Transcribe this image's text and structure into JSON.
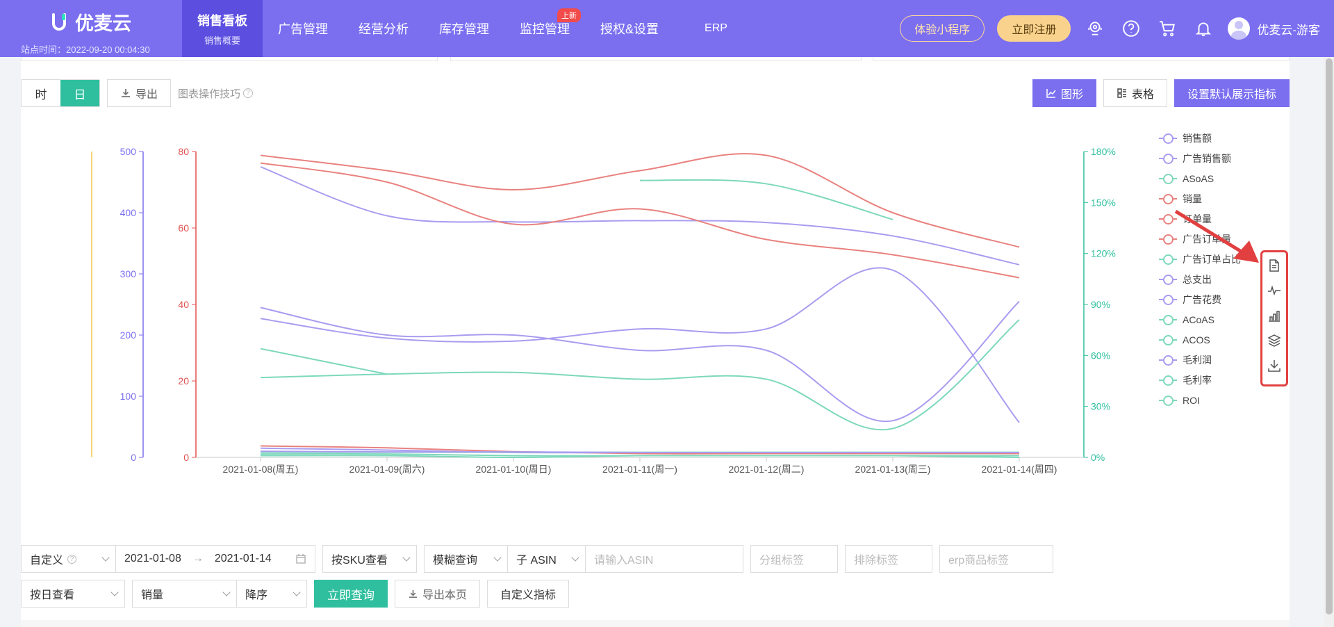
{
  "header": {
    "brand": "优麦云",
    "site_time": "站点时间：2022-09-20 00:04:30",
    "nav": [
      {
        "label": "销售看板",
        "sub": "销售概要",
        "active": true
      },
      {
        "label": "广告管理"
      },
      {
        "label": "经营分析"
      },
      {
        "label": "库存管理"
      },
      {
        "label": "监控管理",
        "badge": "上新"
      },
      {
        "label": "授权&设置"
      },
      {
        "label": "ERP"
      }
    ],
    "mini_program_button": "体验小程序",
    "register_button": "立即注册",
    "user_name": "优麦云-游客"
  },
  "toolbar": {
    "hour": "时",
    "day": "日",
    "export": "导出",
    "tips": "图表操作技巧",
    "graph": "图形",
    "table": "表格",
    "set_default": "设置默认展示指标"
  },
  "chart_data": {
    "type": "line",
    "categories": [
      "2021-01-08(周五)",
      "2021-01-09(周六)",
      "2021-01-10(周日)",
      "2021-01-11(周一)",
      "2021-01-12(周二)",
      "2021-01-13(周三)",
      "2021-01-14(周四)"
    ],
    "y_axes": [
      {
        "ticks": [
          "500",
          "400",
          "300",
          "200",
          "100",
          "0"
        ],
        "color": "#7b6ff0"
      },
      {
        "ticks": [
          "80",
          "60",
          "40",
          "20",
          "0"
        ],
        "color": "#e0514f"
      },
      {
        "ticks": [
          "180%",
          "150%",
          "120%",
          "90%",
          "60%",
          "30%",
          "0%"
        ],
        "color": "#2fbf9e"
      }
    ],
    "series": [
      {
        "name": "销售额",
        "color": "#a99cf0",
        "axis": 0,
        "values": [
          475,
          395,
          385,
          387,
          384,
          362,
          315
        ]
      },
      {
        "name": "广告销售额",
        "color": "#a99cf0",
        "axis": 0,
        "values": [
          227,
          195,
          190,
          210,
          210,
          306,
          57
        ]
      },
      {
        "name": "ASoAS",
        "color": "#7dd8bc",
        "axis": 2,
        "values": [
          null,
          null,
          null,
          163,
          161,
          140,
          null
        ]
      },
      {
        "name": "销量",
        "color": "#e9827f",
        "axis": 1,
        "values": [
          79,
          75,
          70,
          75,
          79,
          64,
          55
        ]
      },
      {
        "name": "订单量",
        "color": "#e9827f",
        "axis": 1,
        "values": [
          77,
          72,
          61,
          65,
          57,
          53,
          47
        ]
      },
      {
        "name": "广告订单量",
        "color": "#e9827f",
        "axis": 1,
        "values": [
          3,
          2.5,
          1.5,
          1,
          1,
          1,
          1
        ]
      },
      {
        "name": "广告订单占比",
        "color": "#7dd8bc",
        "axis": 2,
        "values": [
          47,
          49,
          50,
          46,
          46,
          17,
          81
        ]
      },
      {
        "name": "总支出",
        "color": "#a99cf0",
        "axis": 0,
        "values": [
          245,
          200,
          200,
          175,
          175,
          60,
          255
        ]
      },
      {
        "name": "广告花费",
        "color": "#a99cf0",
        "axis": 0,
        "values": [
          15,
          12,
          8,
          8,
          8,
          8,
          8
        ]
      },
      {
        "name": "ACoAS",
        "color": "#7dd8bc",
        "axis": 2,
        "values": [
          64,
          49,
          null,
          null,
          null,
          null,
          null
        ]
      },
      {
        "name": "ACOS",
        "color": "#7dd8bc",
        "axis": 2,
        "values": [
          3,
          3,
          3,
          3,
          3,
          3,
          3
        ]
      },
      {
        "name": "毛利润",
        "color": "#a99cf0",
        "axis": 0,
        "values": [
          10,
          9,
          9,
          8,
          8,
          8,
          8
        ]
      },
      {
        "name": "毛利率",
        "color": "#7dd8bc",
        "axis": 2,
        "values": [
          2,
          2,
          1,
          1,
          1,
          1,
          1
        ]
      },
      {
        "name": "ROI",
        "color": "#7dd8bc",
        "axis": 2,
        "values": [
          1,
          1,
          0,
          1,
          1,
          1,
          0
        ]
      }
    ]
  },
  "filters": {
    "date_mode": "自定义",
    "date_start": "2021-01-08",
    "date_arrow": "→",
    "date_end": "2021-01-14",
    "view_by": "按SKU查看",
    "match_mode": "模糊查询",
    "asin_type": "子 ASIN",
    "asin_placeholder": "请输入ASIN",
    "group_tag_placeholder": "分组标签",
    "exclude_tag_placeholder": "排除标签",
    "erp_tag_placeholder": "erp商品标签",
    "period": "按日查看",
    "sort_field": "销量",
    "sort_order": "降序",
    "query_button": "立即查询",
    "export_page": "导出本页",
    "custom_metrics": "自定义指标"
  },
  "colors": {
    "brand": "#7b6ff0",
    "accent": "#2fbf9e",
    "annotation": "#e24040"
  }
}
